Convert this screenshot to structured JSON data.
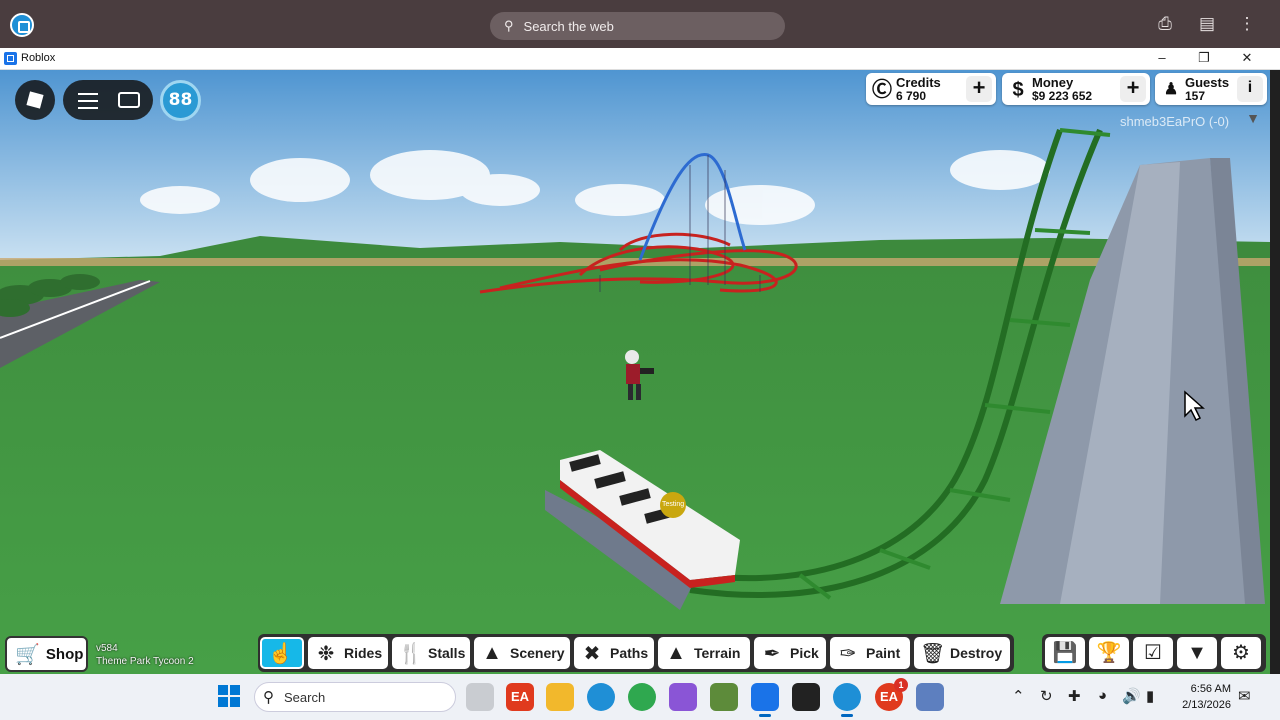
{
  "browser": {
    "search_placeholder": "Search the web"
  },
  "window": {
    "title": "Roblox"
  },
  "hud": {
    "level": "88",
    "credits": {
      "label": "Credits",
      "value": "6 790"
    },
    "money": {
      "label": "Money",
      "value": "$9 223 652",
      "icon": "$"
    },
    "guests": {
      "label": "Guests",
      "value": "157"
    },
    "username": "shmeb3EaPrO (-0)",
    "train_tag": "Testing"
  },
  "toolbar": {
    "shop_label": "Shop",
    "version": "v584",
    "game_name": "Theme Park Tycoon 2",
    "tools": [
      {
        "label": "",
        "icon": "pointer-hand-icon"
      },
      {
        "label": "Rides",
        "icon": "ferris-wheel-icon"
      },
      {
        "label": "Stalls",
        "icon": "cutlery-icon"
      },
      {
        "label": "Scenery",
        "icon": "tree-icon"
      },
      {
        "label": "Paths",
        "icon": "paths-icon"
      },
      {
        "label": "Terrain",
        "icon": "mountain-icon"
      },
      {
        "label": "Pick",
        "icon": "eyedropper-icon"
      },
      {
        "label": "Paint",
        "icon": "brush-icon"
      },
      {
        "label": "Destroy",
        "icon": "trash-icon"
      }
    ],
    "right_tools": [
      "save-icon",
      "trophy-icon",
      "checklist-icon",
      "badge-icon",
      "gear-icon"
    ]
  },
  "taskbar": {
    "search_label": "Search",
    "notification_count": "1",
    "time": "6:56 AM",
    "date": "2/13/2026"
  },
  "colors": {
    "grass": "#3e8d3e",
    "sky_top": "#5a9fd6",
    "coaster_red": "#c8221f",
    "coaster_green": "#2a7a2a",
    "accent_blue": "#16b8e8"
  }
}
